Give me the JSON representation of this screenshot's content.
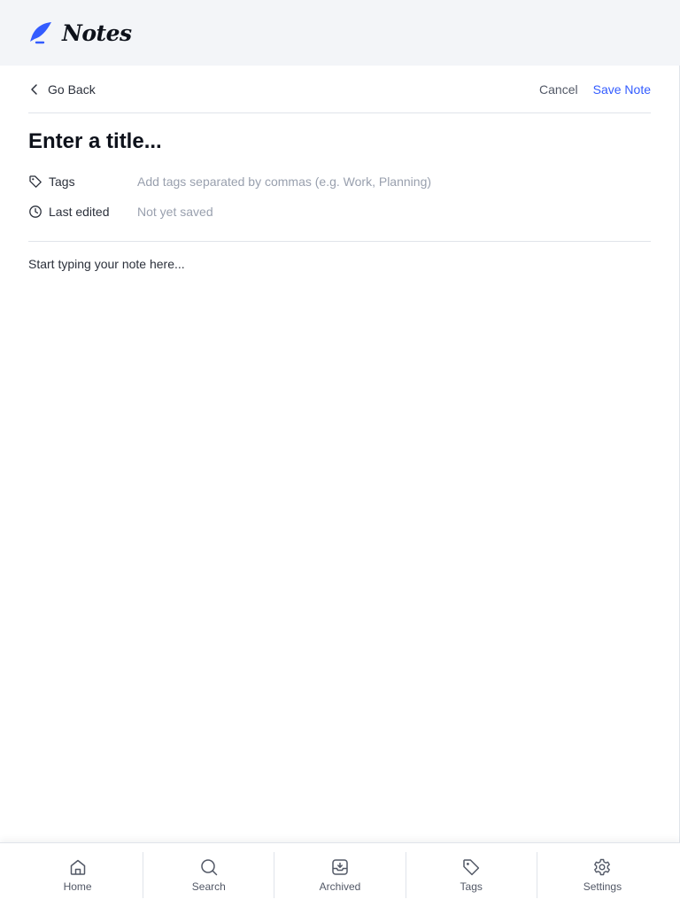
{
  "app": {
    "name": "Notes",
    "logo_icon": "feather-pen-icon",
    "accent_color": "#335cff"
  },
  "topbar": {
    "back_label": "Go Back",
    "cancel_label": "Cancel",
    "save_label": "Save Note"
  },
  "note": {
    "title_placeholder": "Enter a title...",
    "tags_label": "Tags",
    "tags_placeholder": "Add tags separated by commas (e.g. Work, Planning)",
    "last_edited_label": "Last edited",
    "last_edited_value": "Not yet saved",
    "body_placeholder": "Start typing your note here..."
  },
  "nav": {
    "items": [
      {
        "label": "Home",
        "icon": "home-icon"
      },
      {
        "label": "Search",
        "icon": "search-icon"
      },
      {
        "label": "Archived",
        "icon": "archive-icon"
      },
      {
        "label": "Tags",
        "icon": "tag-icon"
      },
      {
        "label": "Settings",
        "icon": "gear-icon"
      }
    ]
  }
}
